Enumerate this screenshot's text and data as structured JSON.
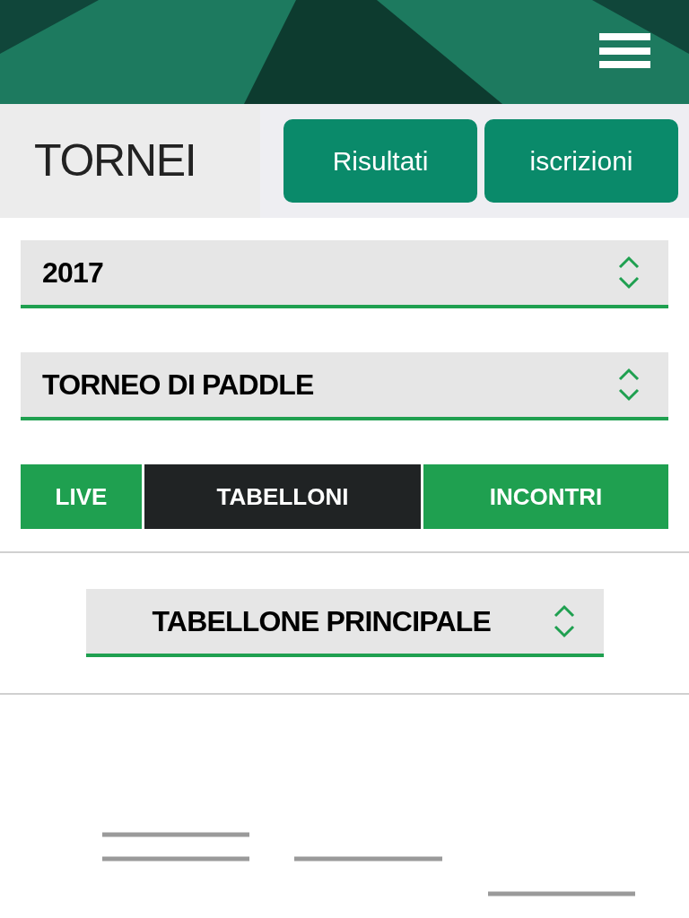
{
  "page_title": "TORNEI",
  "header_buttons": [
    "Risultati",
    "iscrizioni"
  ],
  "filters": [
    {
      "value": "2017"
    },
    {
      "value": "TORNEO DI PADDLE"
    }
  ],
  "tabs": [
    {
      "label": "LIVE",
      "selected": false
    },
    {
      "label": "TABELLONI",
      "selected": true
    },
    {
      "label": "INCONTRI",
      "selected": false
    }
  ],
  "draw_select": {
    "value": "TABELLONE PRINCIPALE"
  }
}
